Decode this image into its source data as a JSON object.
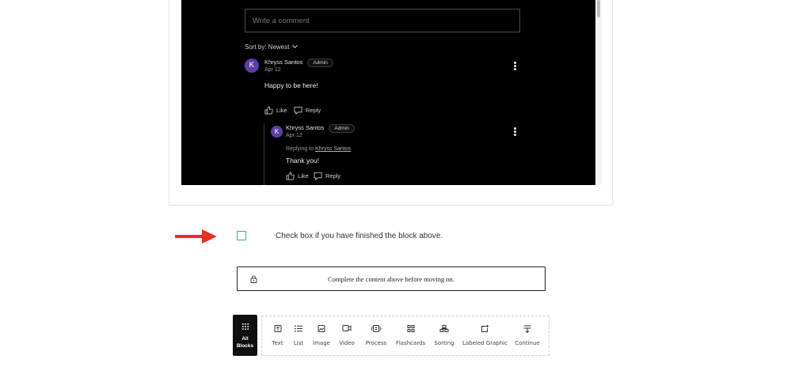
{
  "comments_widget": {
    "input_placeholder": "Write a comment",
    "sort_label": "Sort by: Newest",
    "comment": {
      "avatar_letter": "K",
      "author": "Khryss Santos",
      "badge": "Admin",
      "date": "Apr 12",
      "text": "Happy to be here!",
      "like_label": "Like",
      "reply_label": "Reply"
    },
    "reply": {
      "avatar_letter": "K",
      "author": "Khryss Santos",
      "badge": "Admin",
      "date": "Apr 12",
      "replying_prefix": "Replying to",
      "replying_to": "Khryss Santos",
      "text": "Thank you!",
      "like_label": "Like",
      "reply_label": "Reply"
    }
  },
  "checkbox": {
    "label": "Check box if you have finished the block above.",
    "checked": false,
    "accent": "#3aaa8e"
  },
  "arrow_color": "#e8321e",
  "continue_box": {
    "message": "Complete the content above before moving on.",
    "icon": "lock-icon"
  },
  "block_toolbar": {
    "all_blocks_label_1": "All",
    "all_blocks_label_2": "Blocks",
    "items": [
      {
        "label": "Text",
        "icon": "text-block-icon"
      },
      {
        "label": "List",
        "icon": "list-block-icon"
      },
      {
        "label": "Image",
        "icon": "image-block-icon"
      },
      {
        "label": "Video",
        "icon": "video-block-icon"
      },
      {
        "label": "Process",
        "icon": "process-block-icon"
      },
      {
        "label": "Flashcards",
        "icon": "flashcards-block-icon"
      },
      {
        "label": "Sorting",
        "icon": "sorting-block-icon"
      },
      {
        "label": "Labeled Graphic",
        "icon": "labeled-graphic-block-icon"
      },
      {
        "label": "Continue",
        "icon": "continue-block-icon"
      }
    ]
  }
}
